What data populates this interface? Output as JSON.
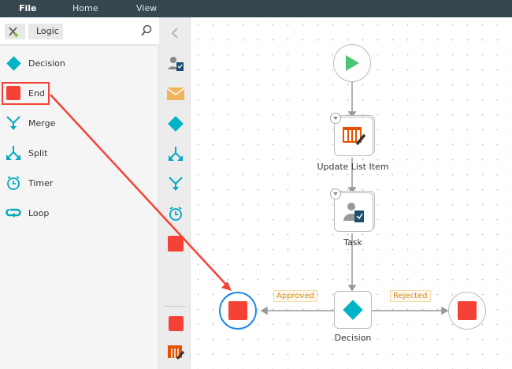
{
  "menu": {
    "file": "File",
    "home": "Home",
    "view": "View"
  },
  "breadcrumb": {
    "label": "Logic"
  },
  "palette": [
    {
      "label": "Decision",
      "icon": "diamond-icon"
    },
    {
      "label": "End",
      "icon": "end-square-icon"
    },
    {
      "label": "Merge",
      "icon": "merge-icon"
    },
    {
      "label": "Split",
      "icon": "split-icon"
    },
    {
      "label": "Timer",
      "icon": "timer-icon"
    },
    {
      "label": "Loop",
      "icon": "loop-icon"
    }
  ],
  "canvas": {
    "nodes": {
      "update": "Update List Item",
      "task": "Task",
      "decision": "Decision"
    },
    "edges": {
      "approved": "Approved",
      "rejected": "Rejected"
    }
  },
  "colors": {
    "accent": "#00b3c7",
    "end": "#f44336",
    "start": "#4cc475",
    "highlight": "#f44336",
    "selected": "#1e88e5"
  }
}
